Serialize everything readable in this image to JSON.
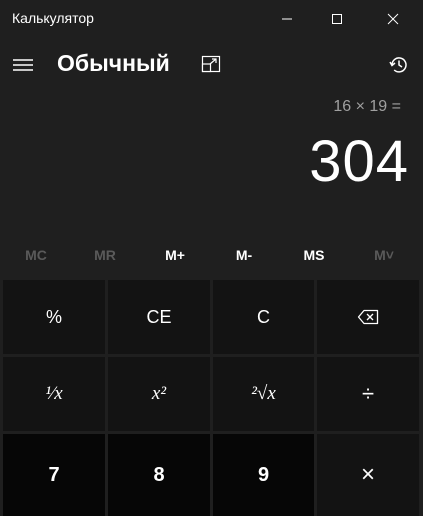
{
  "window": {
    "title": "Калькулятор"
  },
  "header": {
    "mode": "Обычный"
  },
  "display": {
    "expression": "16 × 19 =",
    "result": "304"
  },
  "memory": [
    {
      "label": "MC",
      "enabled": false
    },
    {
      "label": "MR",
      "enabled": false
    },
    {
      "label": "M+",
      "enabled": true
    },
    {
      "label": "M-",
      "enabled": true
    },
    {
      "label": "MS",
      "enabled": true
    },
    {
      "label": "M˅",
      "enabled": false
    }
  ],
  "keys": {
    "percent": "%",
    "ce": "CE",
    "c": "C",
    "reciprocal": "¹⁄x",
    "square": "x²",
    "sqrt": "²√x",
    "divide": "÷",
    "seven": "7",
    "eight": "8",
    "nine": "9",
    "multiply": "×"
  },
  "colors": {
    "background": "#1f1f1f",
    "function_key": "#131313",
    "number_key": "#060606",
    "disabled_text": "#5a5a5a",
    "secondary_text": "#a0a0a0"
  },
  "icons": {
    "minimize": "minimize-icon",
    "maximize": "maximize-icon",
    "close": "close-icon",
    "menu": "hamburger-menu-icon",
    "keep_on_top": "keep-on-top-icon",
    "history": "history-icon",
    "backspace": "backspace-icon"
  }
}
